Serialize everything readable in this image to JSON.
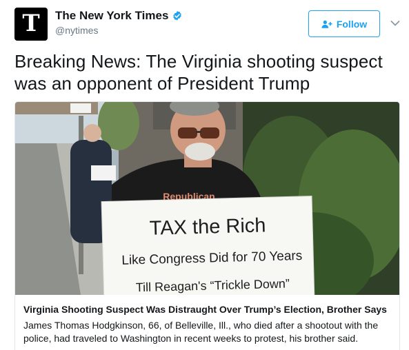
{
  "author": {
    "avatar_letter": "T",
    "display_name": "The New York Times",
    "handle": "@nytimes",
    "verified": true
  },
  "follow_button": {
    "label": "Follow"
  },
  "tweet": {
    "text": "Breaking News: The Virginia shooting suspect was an opponent of President Trump"
  },
  "card": {
    "image": {
      "sign_line1": "TAX the Rich",
      "sign_line2": "Like Congress Did for 70 Years",
      "sign_line3": "Till Reagan's “Trickle Down”",
      "shirt_text": "Republican"
    },
    "headline": "Virginia Shooting Suspect Was Distraught Over Trump’s Election, Brother Says",
    "description": "James Thomas Hodgkinson, 66, of Belleville, Ill., who died after a shootout with the police, had traveled to Washington in recent weeks to protest, his brother said."
  },
  "colors": {
    "accent": "#1da1f2",
    "text": "#14171a",
    "secondary_text": "#657786",
    "border": "#e1e8ed"
  },
  "icons": {
    "verified": "verified-badge-icon",
    "follow": "follow-user-icon",
    "menu": "chevron-down-icon"
  }
}
